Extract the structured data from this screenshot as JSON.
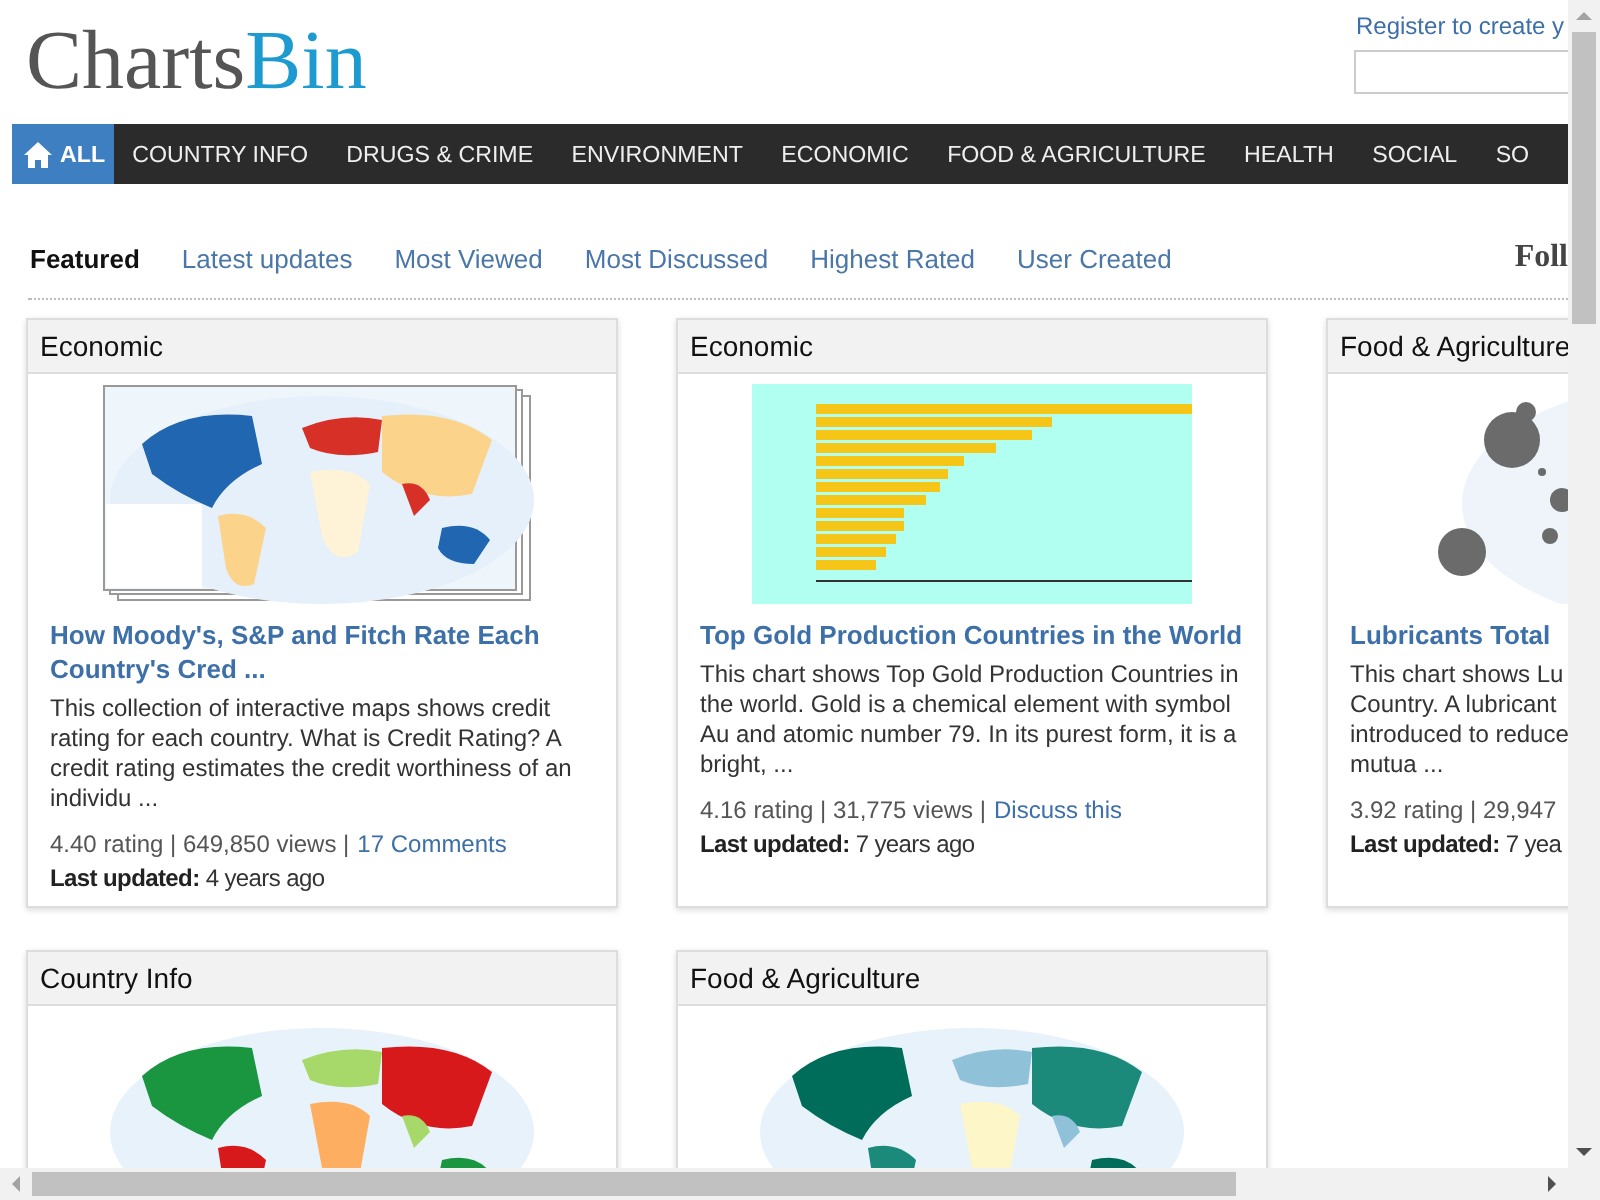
{
  "logo": {
    "part_1": "Charts",
    "part_2": "Bin"
  },
  "account": {
    "register_link": "Register to create y"
  },
  "nav": [
    {
      "label": "ALL",
      "selected": true
    },
    {
      "label": "COUNTRY INFO",
      "selected": false
    },
    {
      "label": "DRUGS & CRIME",
      "selected": false
    },
    {
      "label": "ENVIRONMENT",
      "selected": false
    },
    {
      "label": "ECONOMIC",
      "selected": false
    },
    {
      "label": "FOOD & AGRICULTURE",
      "selected": false
    },
    {
      "label": "HEALTH",
      "selected": false
    },
    {
      "label": "SOCIAL",
      "selected": false
    },
    {
      "label": "SO",
      "selected": false
    }
  ],
  "tabs": [
    {
      "label": "Featured",
      "selected": true
    },
    {
      "label": "Latest updates",
      "selected": false
    },
    {
      "label": "Most Viewed",
      "selected": false
    },
    {
      "label": "Most Discussed",
      "selected": false
    },
    {
      "label": "Highest Rated",
      "selected": false
    },
    {
      "label": "User Created",
      "selected": false
    }
  ],
  "side_heading": "Foll",
  "cards": [
    {
      "category": "Economic",
      "title": "How Moody's, S&P and Fitch Rate Each\nCountry's Cred ...",
      "description": "This collection of interactive maps shows credit\nrating for each country. What is Credit Rating? A\ncredit rating estimates the credit worthiness of an\nindividu ...",
      "stats": "4.40 rating | 649,850 views |",
      "link": "17 Comments",
      "updated_label": "Last updated:",
      "updated": "4 years ago"
    },
    {
      "category": "Economic",
      "title": "Top Gold Production Countries in the World",
      "description": "This chart shows Top Gold Production Countries in\nthe world. Gold is a chemical element with symbol\nAu and atomic number 79. In its purest form, it is a\nbright, ...",
      "stats": "4.16 rating | 31,775 views |",
      "link": "Discuss this",
      "updated_label": "Last updated:",
      "updated": "7 years ago"
    },
    {
      "category": "Food & Agriculture",
      "title": "Lubricants Total",
      "description": "This chart shows Lu\nCountry. A lubricant\nintroduced to reduce\nmutua ...",
      "stats": "3.92 rating | 29,947",
      "updated_label": "Last updated:",
      "updated": "7 yea"
    },
    {
      "category": "Country Info"
    },
    {
      "category": "Food & Agriculture"
    }
  ]
}
